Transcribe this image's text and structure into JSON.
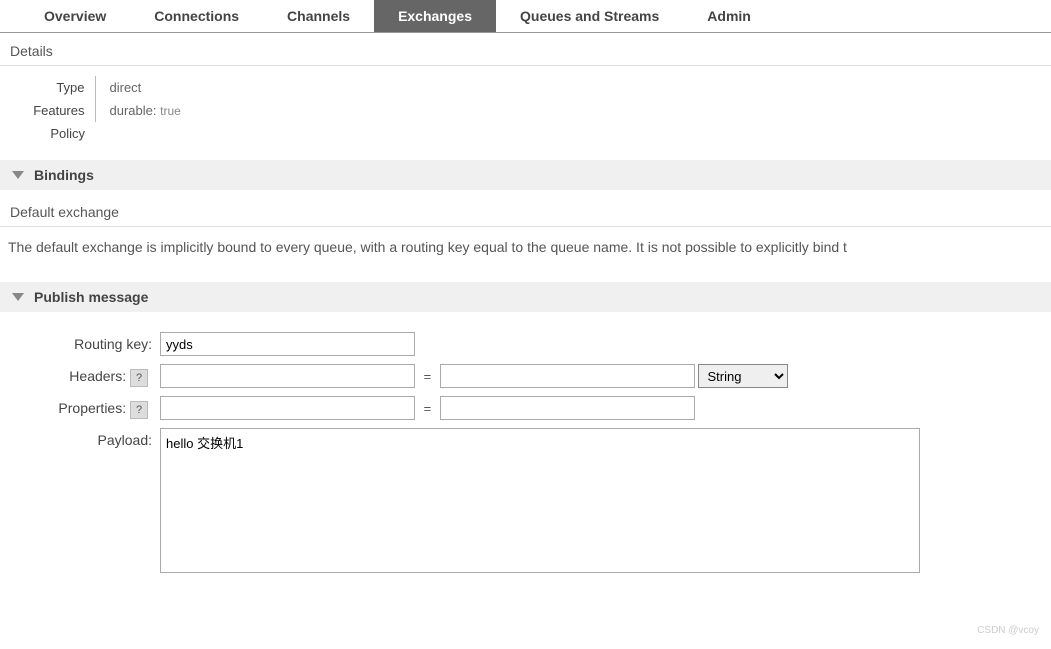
{
  "tabs": {
    "overview": "Overview",
    "connections": "Connections",
    "channels": "Channels",
    "exchanges": "Exchanges",
    "queues": "Queues and Streams",
    "admin": "Admin"
  },
  "details": {
    "title": "Details",
    "type_label": "Type",
    "type_value": "direct",
    "features_label": "Features",
    "features_key": "durable:",
    "features_value": "true",
    "policy_label": "Policy"
  },
  "bindings": {
    "title": "Bindings",
    "subtitle": "Default exchange",
    "description": "The default exchange is implicitly bound to every queue, with a routing key equal to the queue name. It is not possible to explicitly bind t"
  },
  "publish": {
    "title": "Publish message",
    "routing_key_label": "Routing key:",
    "routing_key_value": "yyds",
    "headers_label": "Headers:",
    "properties_label": "Properties:",
    "payload_label": "Payload:",
    "payload_value": "hello 交换机1",
    "type_option": "String",
    "equals": "=",
    "help": "?"
  },
  "watermark": "CSDN @vcoy"
}
